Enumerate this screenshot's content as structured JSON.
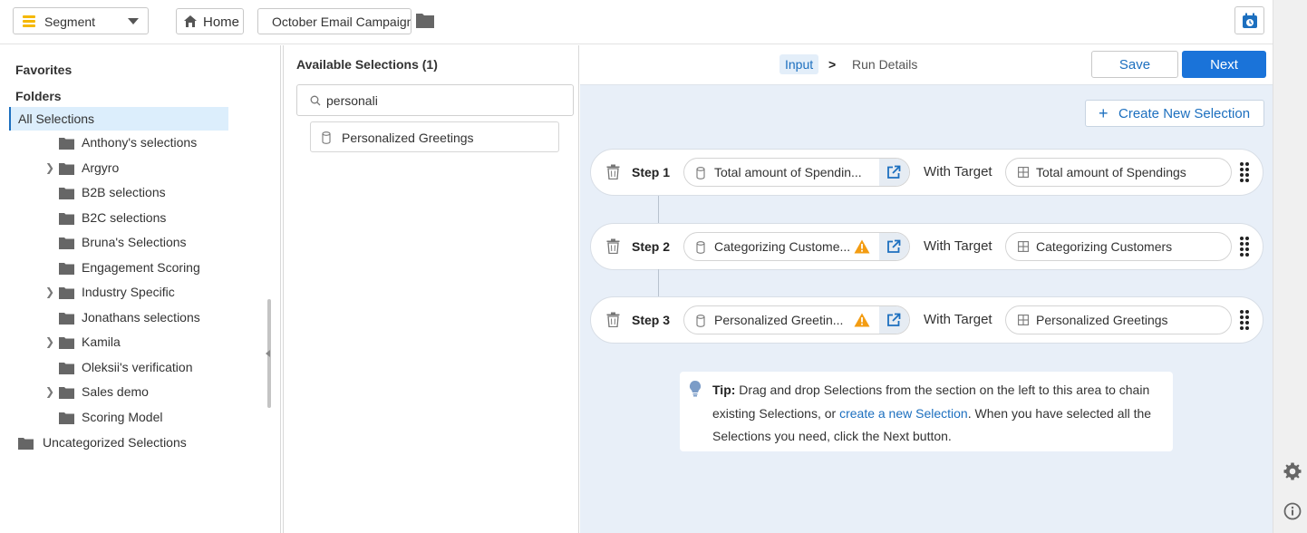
{
  "topbar": {
    "segment_label": "Segment",
    "home_label": "Home",
    "campaign_name": "October Email Campaign"
  },
  "left": {
    "favorites": "Favorites",
    "folders": "Folders",
    "all_selections": "All Selections",
    "items": [
      {
        "label": "Anthony's selections",
        "expandable": false
      },
      {
        "label": "Argyro",
        "expandable": true
      },
      {
        "label": "B2B selections",
        "expandable": false
      },
      {
        "label": "B2C selections",
        "expandable": false
      },
      {
        "label": "Bruna's Selections",
        "expandable": false
      },
      {
        "label": "Engagement Scoring",
        "expandable": false
      },
      {
        "label": "Industry Specific",
        "expandable": true
      },
      {
        "label": "Jonathans selections",
        "expandable": false
      },
      {
        "label": "Kamila",
        "expandable": true
      },
      {
        "label": "Oleksii's verification",
        "expandable": false
      },
      {
        "label": "Sales demo",
        "expandable": true
      },
      {
        "label": "Scoring Model",
        "expandable": false
      }
    ],
    "uncategorized": "Uncategorized Selections"
  },
  "middle": {
    "title": "Available Selections (1)",
    "search_value": "personali",
    "results": [
      "Personalized Greetings"
    ]
  },
  "right": {
    "crumb_input": "Input",
    "crumb_sep": ">",
    "crumb_run": "Run Details",
    "save_label": "Save",
    "next_label": "Next",
    "create_label": "Create New Selection",
    "with_target": "With Target",
    "steps": [
      {
        "label": "Step 1",
        "source": "Total amount of Spendin...",
        "warning": false,
        "target": "Total amount of Spendings"
      },
      {
        "label": "Step 2",
        "source": "Categorizing Custome...",
        "warning": true,
        "target": "Categorizing Customers"
      },
      {
        "label": "Step 3",
        "source": "Personalized Greetin...",
        "warning": true,
        "target": "Personalized Greetings"
      }
    ],
    "tip": {
      "bold": "Tip:",
      "part1": " Drag and drop Selections from the section on the left to this area to chain existing Selections, or ",
      "link": "create a new Selection",
      "part2": ". When you have selected all the Selections you need, click the Next button."
    }
  },
  "colors": {
    "accent": "#1a73d9",
    "selected_bg": "#dceefc",
    "canvas_bg": "#e8eff8",
    "warning": "#f39c12",
    "segment_icon": "#f5b800"
  }
}
